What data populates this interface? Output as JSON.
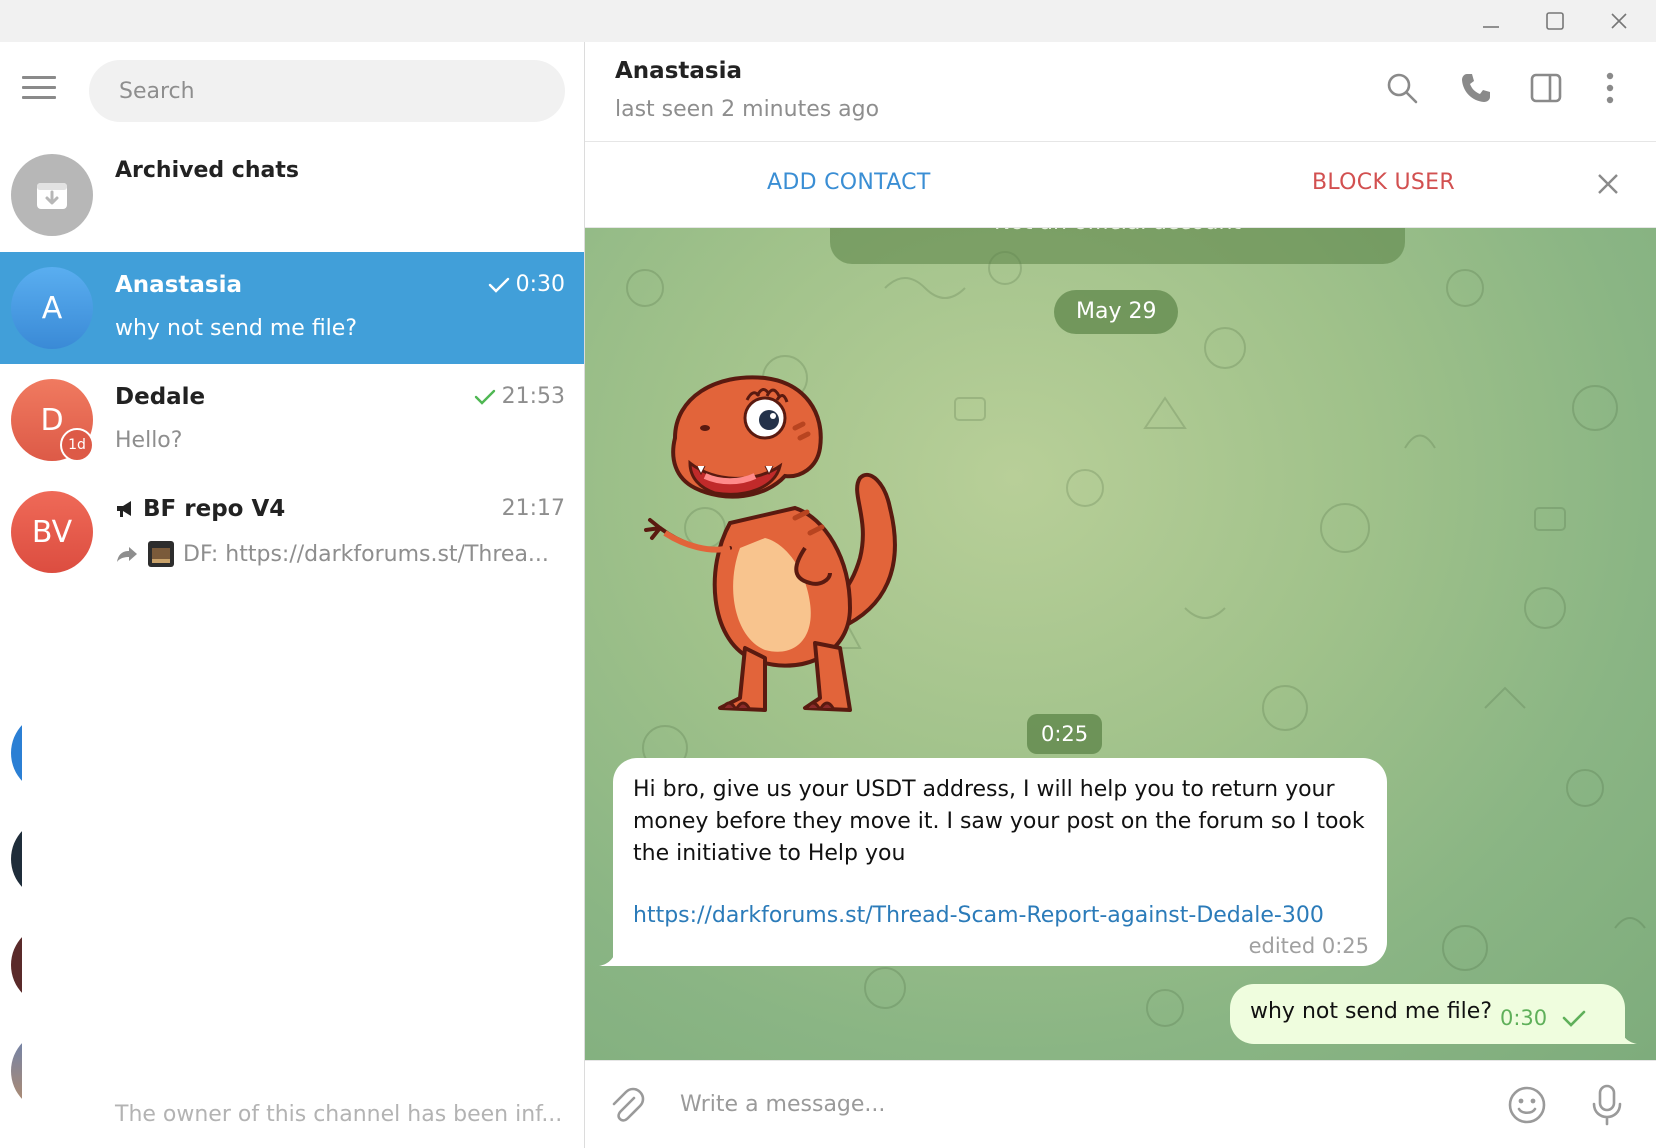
{
  "window": {
    "controls": {
      "minimize_icon": "minimize-icon",
      "maximize_icon": "maximize-icon",
      "close_icon": "close-icon"
    }
  },
  "sidebar": {
    "search": {
      "placeholder": "Search"
    },
    "archived": {
      "title": "Archived chats"
    },
    "chats": [
      {
        "avatar_initials": "A",
        "name": "Anastasia",
        "time": "0:30",
        "preview": "why not send me file?",
        "active": true,
        "read": true,
        "avatar_color": "#4a9be0"
      },
      {
        "avatar_initials": "D",
        "name": "Dedale",
        "time": "21:53",
        "preview": "Hello?",
        "badge": "1d",
        "read": true,
        "avatar_color": "#e96b55"
      },
      {
        "avatar_initials": "BV",
        "name": "BF repo V4",
        "time": "21:17",
        "preview": "DF: https://darkforums.st/Threa...",
        "channel": true,
        "avatar_color": "#e55c4d"
      }
    ],
    "footer_preview": "The owner of this channel has been inf..."
  },
  "chat": {
    "peer_name": "Anastasia",
    "peer_status": "last seen 2 minutes ago",
    "actions": {
      "add_contact": "ADD CONTACT",
      "block_user": "BLOCK USER"
    },
    "notice": "Not an official account",
    "date_separator": "May 29",
    "sticker_time": "0:25",
    "messages": [
      {
        "direction": "in",
        "text": "Hi bro, give us your USDT address, I will help you to return your money before they move it. I saw your post on the forum so I took the initiative to Help you",
        "link": "https://darkforums.st/Thread-Scam-Report-against-Dedale-300",
        "meta": "edited 0:25"
      },
      {
        "direction": "out",
        "text": "why not send me file?",
        "time": "0:30",
        "status": "sent"
      }
    ],
    "composer": {
      "placeholder": "Write a message..."
    }
  },
  "colors": {
    "accent": "#419fd9",
    "link": "#2b7bb9",
    "block": "#d25050",
    "out_bubble": "#effdde",
    "check": "#5fb05a"
  }
}
